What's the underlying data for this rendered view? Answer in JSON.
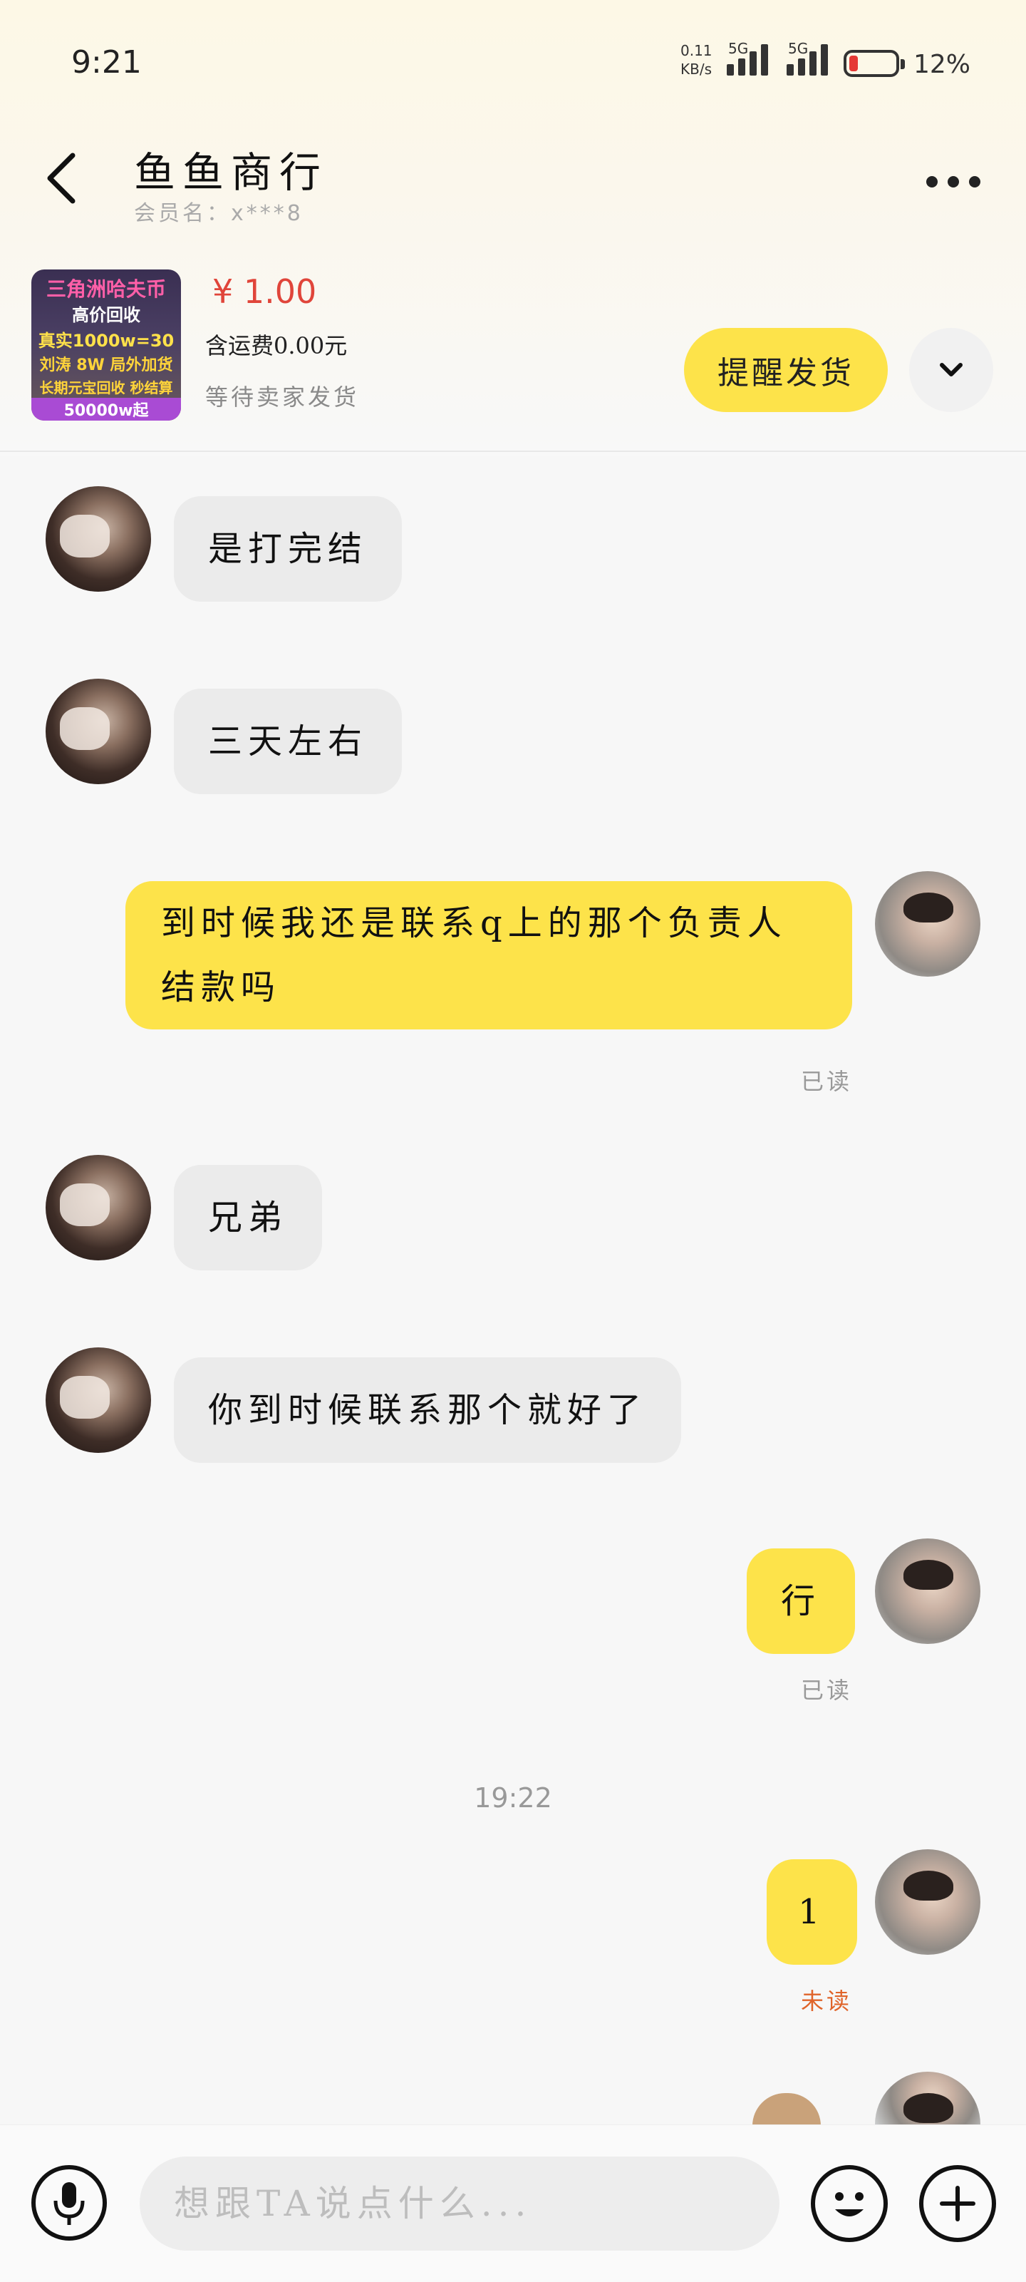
{
  "status_bar": {
    "time": "9:21",
    "net_speed_value": "0.11",
    "net_speed_unit": "KB/s",
    "signal1_label": "5G",
    "signal2_label": "5G",
    "battery_percent": "12%"
  },
  "header": {
    "title": "鱼鱼商行",
    "member_label": "会员名：x***8"
  },
  "order": {
    "thumbnail_lines": [
      "三角洲哈夫币",
      "高价回收",
      "真实1000w=30",
      "刘涛 8W 局外加货",
      "长期元宝回收 秒结算",
      "50000w起"
    ],
    "price": "¥ 1.00",
    "shipping": "含运费0.00元",
    "status": "等待卖家发货",
    "remind_button": "提醒发货"
  },
  "messages": [
    {
      "from": "seller",
      "text": "是打完结"
    },
    {
      "from": "seller",
      "text": "三天左右"
    },
    {
      "from": "me",
      "text": "到时候我还是联系q上的那个负责人结款吗",
      "read": "已读"
    },
    {
      "from": "seller",
      "text": "兄弟"
    },
    {
      "from": "seller",
      "text": "你到时候联系那个就好了"
    },
    {
      "from": "me",
      "text": "行",
      "read": "已读"
    },
    {
      "from": "me",
      "text": "1",
      "read": "未读"
    }
  ],
  "timestamp": "19:22",
  "composer": {
    "placeholder": "想跟TA说点什么..."
  },
  "colors": {
    "accent_yellow": "#fde34a",
    "price_red": "#e0453a",
    "unread_orange": "#e0642a"
  }
}
